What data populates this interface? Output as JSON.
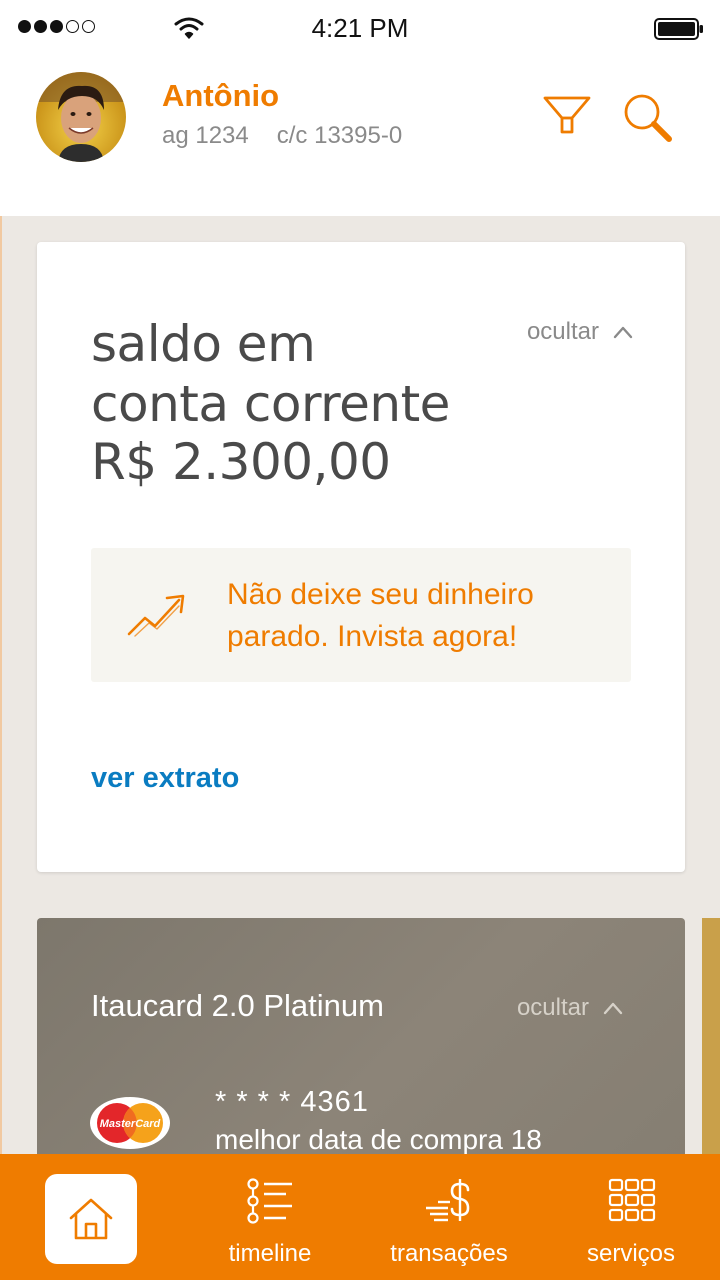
{
  "status_bar": {
    "time": "4:21 PM"
  },
  "header": {
    "user_name": "Antônio",
    "agency": "ag 1234",
    "account": "c/c 13395-0",
    "icons": [
      "filter-icon",
      "search-icon"
    ]
  },
  "balance_card": {
    "title_line1": "saldo em",
    "title_line2": "conta corrente",
    "amount": "R$ 2.300,00",
    "hide_label": "ocultar",
    "invest_banner": "Não deixe seu dinheiro parado. Invista agora!",
    "statement_link": "ver extrato"
  },
  "credit_card": {
    "name": "Itaucard 2.0 Platinum",
    "hide_label": "ocultar",
    "number": "* * * *  4361",
    "best_date": "melhor data de compra 18",
    "brand_logo_text": "MasterCard"
  },
  "bottom_nav": {
    "items": [
      {
        "label": "",
        "icon": "home-icon",
        "active": true
      },
      {
        "label": "timeline",
        "icon": "timeline-icon"
      },
      {
        "label": "transações",
        "icon": "transactions-icon"
      },
      {
        "label": "serviços",
        "icon": "services-icon"
      }
    ]
  },
  "colors": {
    "accent": "#ef7c00",
    "link": "#0a7cc1",
    "background": "#ece8e3"
  }
}
